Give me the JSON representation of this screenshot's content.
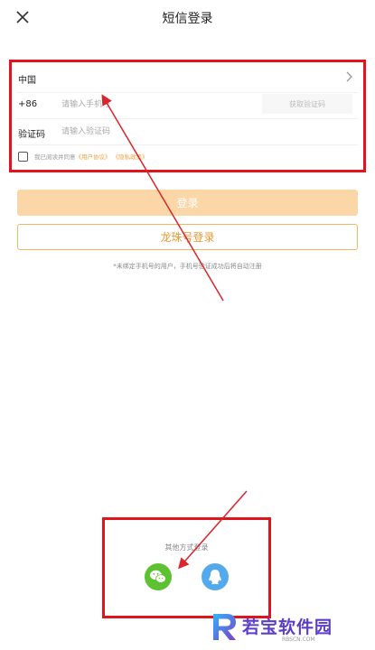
{
  "header": {
    "title": "短信登录",
    "close_icon": "close-icon"
  },
  "form": {
    "country": "中国",
    "country_code": "+86",
    "phone_placeholder": "请输入手机号",
    "get_code_label": "获取验证码",
    "code_label": "验证码",
    "code_placeholder": "请输入验证码",
    "agree_prefix": "我已阅读并同意",
    "user_agreement": "《用户协议》",
    "privacy_policy": "《隐私政策》"
  },
  "actions": {
    "login_label": "登录",
    "longzhu_login_label": "龙珠号登录",
    "hint": "*未绑定手机号的用户，手机号验证成功后将自动注册"
  },
  "other_login": {
    "label": "其他方式登录",
    "providers": [
      "wechat-icon",
      "qq-icon"
    ]
  },
  "watermark": {
    "text": "若宝软件园",
    "url": "RBSCN.COM"
  },
  "colors": {
    "accent": "#e79a34",
    "login_button_bg": "#fbd7a8",
    "highlight_red": "#e1131b",
    "wechat_green": "#5dc231",
    "qq_blue": "#54a9ec"
  }
}
